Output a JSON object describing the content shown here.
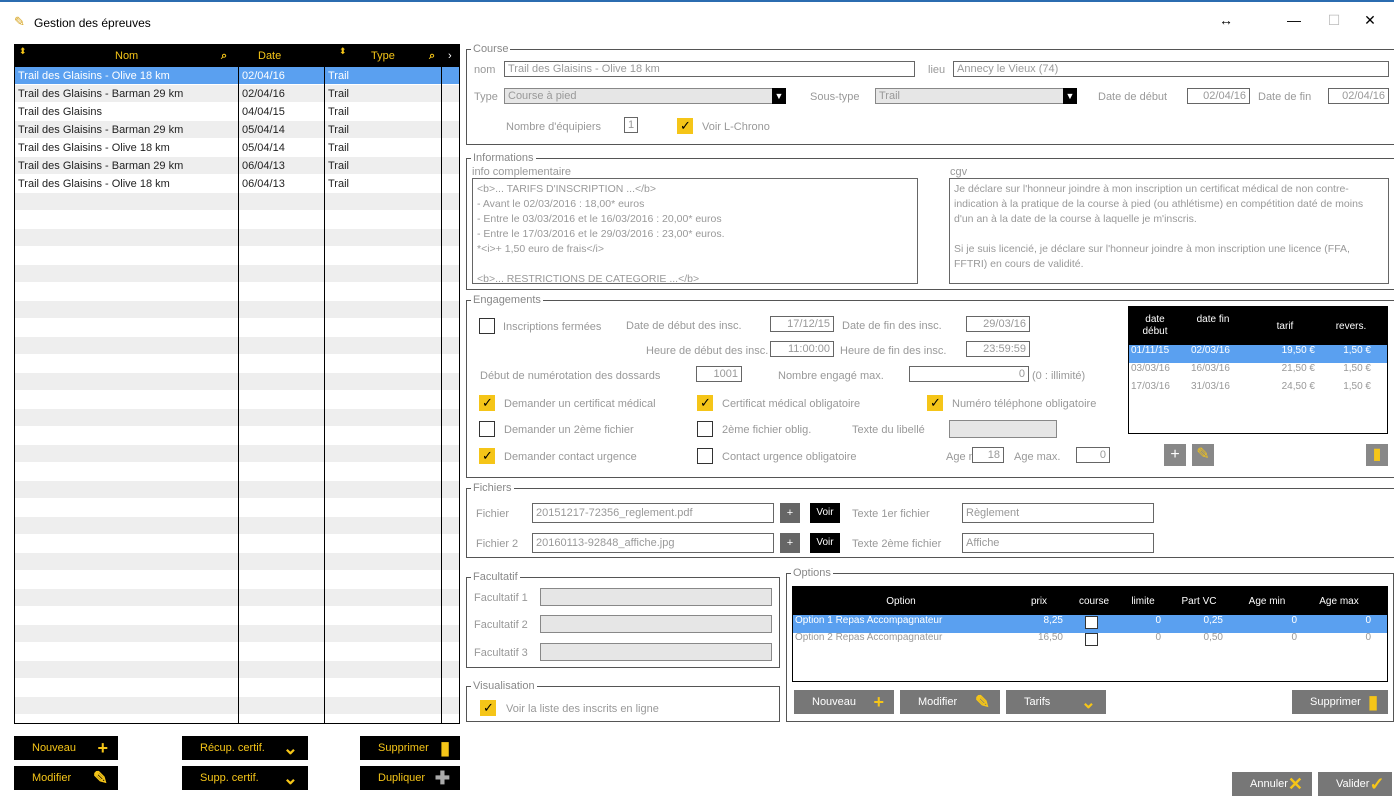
{
  "window": {
    "title": "Gestion des épreuves"
  },
  "list": {
    "headers": {
      "nom": "Nom",
      "date": "Date",
      "type": "Type"
    },
    "rows": [
      {
        "nom": "Trail des Glaisins - Olive 18 km",
        "date": "02/04/16",
        "type": "Trail",
        "selected": true
      },
      {
        "nom": "Trail des Glaisins - Barman 29 km",
        "date": "02/04/16",
        "type": "Trail"
      },
      {
        "nom": "Trail des Glaisins",
        "date": "04/04/15",
        "type": "Trail"
      },
      {
        "nom": "Trail des Glaisins - Barman 29 km",
        "date": "05/04/14",
        "type": "Trail"
      },
      {
        "nom": "Trail des Glaisins - Olive 18 km",
        "date": "05/04/14",
        "type": "Trail"
      },
      {
        "nom": "Trail des Glaisins - Barman 29 km",
        "date": "06/04/13",
        "type": "Trail"
      },
      {
        "nom": "Trail des Glaisins - Olive 18 km",
        "date": "06/04/13",
        "type": "Trail"
      }
    ],
    "buttons": {
      "nouveau": "Nouveau",
      "recup": "Récup. certif.",
      "supprimer": "Supprimer",
      "modifier": "Modifier",
      "supp": "Supp. certif.",
      "dupliquer": "Dupliquer"
    }
  },
  "course": {
    "legend": "Course",
    "nom_label": "nom",
    "nom": "Trail des Glaisins - Olive 18 km",
    "lieu_label": "lieu",
    "lieu": "Annecy le Vieux (74)",
    "type_label": "Type",
    "type": "Course à pied",
    "soustype_label": "Sous-type",
    "soustype": "Trail",
    "debut_label": "Date de début",
    "debut": "02/04/16",
    "fin_label": "Date de fin",
    "fin": "02/04/16",
    "equipiers_label": "Nombre d'équipiers",
    "equipiers": "1",
    "lchrono_label": "Voir L-Chrono"
  },
  "info": {
    "legend": "Informations",
    "comp_label": "info complementaire",
    "comp_lines": [
      "<b>... TARIFS D'INSCRIPTION ...</b>",
      "- Avant le 02/03/2016 : 18,00* euros",
      "- Entre le 03/03/2016 et le 16/03/2016 : 20,00* euros",
      "- Entre le 17/03/2016 et le 29/03/2016 : 23,00* euros.",
      "*<i>+ 1,50 euro de frais</i>",
      "",
      "<b>... RESTRICTIONS DE CATEGORIE ...</b>"
    ],
    "cgv_label": "cgv",
    "cgv_lines": [
      "Je déclare sur l'honneur joindre à mon inscription un certificat médical de non contre-",
      "indication à la pratique de la course à pied (ou athlétisme) en compétition daté de moins",
      "d'un an à la date de la course à laquelle je m'inscris.",
      "",
      "Si je suis licencié, je déclare sur l'honneur joindre à mon inscription une licence (FFA,",
      "FFTRI) en cours de validité."
    ]
  },
  "eng": {
    "legend": "Engagements",
    "fermees": "Inscriptions fermées",
    "debut_insc_label": "Date de début des insc.",
    "debut_insc": "17/12/15",
    "fin_insc_label": "Date de fin des insc.",
    "fin_insc": "29/03/16",
    "hdebut_label": "Heure de début des insc.",
    "hdebut": "11:00:00",
    "hfin_label": "Heure de fin des insc.",
    "hfin": "23:59:59",
    "dossard_label": "Début de numérotation des dossards",
    "dossard": "1001",
    "max_label": "Nombre engagé max.",
    "max": "0",
    "max_note": "(0 : illimité)",
    "certif": "Demander un certificat médical",
    "certif_obl": "Certificat médical obligatoire",
    "tel_obl": "Numéro téléphone obligatoire",
    "fich2": "Demander un 2ème fichier",
    "fich2_obl": "2ème fichier oblig.",
    "libelle": "Texte du libellé",
    "urgence": "Demander contact urgence",
    "urgence_obl": "Contact urgence obligatoire",
    "agemin_label": "Age min.",
    "agemin": "18",
    "agemax_label": "Age max.",
    "agemax": "0",
    "tarifs": {
      "headers": [
        "date début",
        "date fin",
        "tarif",
        "revers."
      ],
      "rows": [
        [
          "01/11/15",
          "02/03/16",
          "19,50 €",
          "1,50 €"
        ],
        [
          "03/03/16",
          "16/03/16",
          "21,50 €",
          "1,50 €"
        ],
        [
          "17/03/16",
          "31/03/16",
          "24,50 €",
          "1,50 €"
        ]
      ]
    }
  },
  "fichiers": {
    "legend": "Fichiers",
    "f1_label": "Fichier",
    "f1": "20151217-72356_reglement.pdf",
    "f2_label": "Fichier 2",
    "f2": "20160113-92848_affiche.jpg",
    "voir": "Voir",
    "t1_label": "Texte 1er fichier",
    "t1": "Règlement",
    "t2_label": "Texte 2ème fichier",
    "t2": "Affiche"
  },
  "facultatif": {
    "legend": "Facultatif",
    "f1": "Facultatif 1",
    "f2": "Facultatif 2",
    "f3": "Facultatif 3"
  },
  "visu": {
    "legend": "Visualisation",
    "label": "Voir la liste des inscrits en ligne"
  },
  "options": {
    "legend": "Options",
    "headers": [
      "Option",
      "prix",
      "course",
      "limite",
      "Part VC",
      "Age min",
      "Age max"
    ],
    "rows": [
      {
        "option": "Option 1 Repas Accompagnateur",
        "prix": "8,25",
        "limite": "0",
        "part": "0,25",
        "agemin": "0",
        "agemax": "0",
        "selected": true
      },
      {
        "option": "Option 2 Repas Accompagnateur",
        "prix": "16,50",
        "limite": "0",
        "part": "0,50",
        "agemin": "0",
        "agemax": "0"
      }
    ],
    "buttons": {
      "nouveau": "Nouveau",
      "modifier": "Modifier",
      "tarifs": "Tarifs",
      "supprimer": "Supprimer"
    }
  },
  "footer": {
    "annuler": "Annuler",
    "valider": "Valider"
  }
}
